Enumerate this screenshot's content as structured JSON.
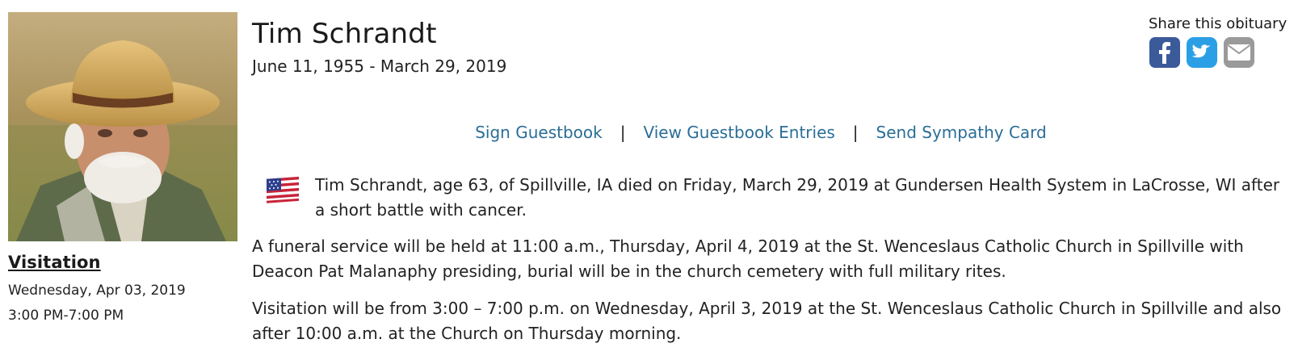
{
  "person": {
    "name": "Tim Schrandt",
    "dates": "June 11, 1955 - March 29, 2019"
  },
  "visitation": {
    "title": "Visitation",
    "date": "Wednesday, Apr 03, 2019",
    "time": "3:00 PM-7:00 PM"
  },
  "share": {
    "label": "Share this obituary",
    "icons": [
      "facebook-icon",
      "twitter-icon",
      "email-icon"
    ]
  },
  "actions": {
    "sign_guestbook": "Sign Guestbook",
    "view_guestbook": "View Guestbook Entries",
    "send_card": "Send Sympathy Card",
    "separator": "|"
  },
  "obituary": {
    "paragraphs": [
      "Tim Schrandt, age 63, of Spillville, IA died on Friday, March 29, 2019 at Gundersen Health System in LaCrosse, WI after a short battle with cancer.",
      "A funeral service will be held at 11:00 a.m., Thursday, April 4, 2019 at the St. Wenceslaus Catholic Church in Spillville with Deacon Pat Malanaphy presiding, burial will be in the church cemetery with full military rites.",
      "Visitation will be from 3:00 – 7:00 p.m. on Wednesday, April 3, 2019 at the St. Wenceslaus Catholic Church in Spillville and also after 10:00 a.m. at the Church on Thursday morning."
    ]
  },
  "colors": {
    "link": "#2a6e96",
    "facebook": "#3b5a9a",
    "twitter": "#2a9fe6",
    "email": "#9a9a9a"
  }
}
